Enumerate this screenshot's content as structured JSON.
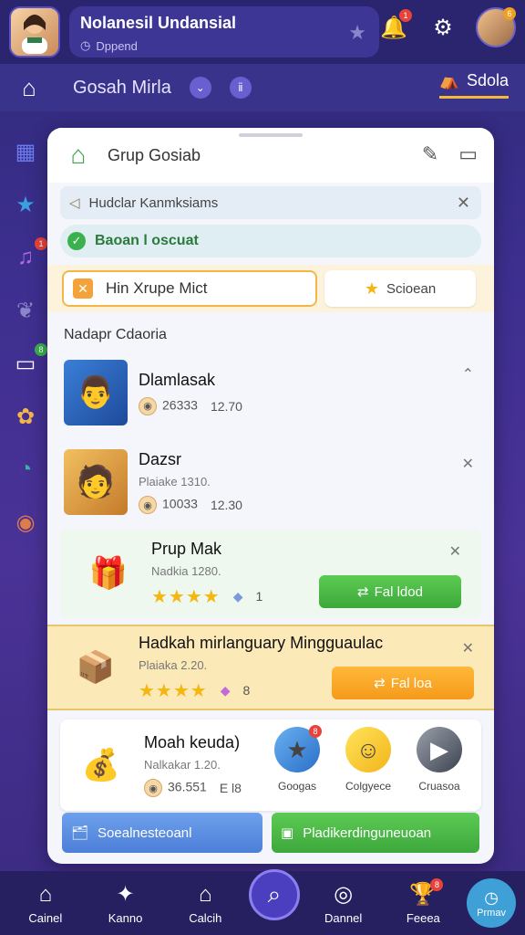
{
  "header": {
    "user_name": "Nolanesil Undansial",
    "user_status": "Dppend",
    "bell_badge": "1",
    "avatar_badge": "6"
  },
  "nav": {
    "title": "Gosah Mirla",
    "right_label": "Sdola"
  },
  "sidebar": {
    "items": [
      {
        "icon": "grid-icon",
        "color": "#6a7cf0"
      },
      {
        "icon": "star-icon",
        "color": "#3aa0e0"
      },
      {
        "icon": "music-icon",
        "color": "#b06ae8",
        "badge": "1"
      },
      {
        "icon": "leaf-icon",
        "color": "#8a86c9"
      },
      {
        "icon": "tablet-icon",
        "color": "#ffffff",
        "badge": "8"
      },
      {
        "icon": "gear-icon",
        "color": "#f3b64a"
      },
      {
        "icon": "compass-icon",
        "color": "#3bb3a4"
      },
      {
        "icon": "shell-icon",
        "color": "#e07c4a"
      }
    ]
  },
  "panel": {
    "title": "Grup Gosiab",
    "notice_text": "Hudclar Kanmksiams",
    "success_text": "Baoan l oscuat",
    "mission_label": "Hin Xrupe Mict",
    "secondary_label": "Scioean",
    "section_title": "Nadapr Cdaoria",
    "items": [
      {
        "title": "Dlamlasak",
        "meta1": "26333",
        "meta2": "12.70"
      },
      {
        "title": "Dazsr",
        "sub": "Plaiake 1310.",
        "meta1": "10033",
        "meta2": "12.30"
      },
      {
        "title": "Prup Mak",
        "sub": "Nadkia 1280.",
        "stars": "★★★★",
        "extra": "1",
        "action": "Fal ldod"
      },
      {
        "title": "Hadkah mirlanguary Mingguaulac",
        "sub": "Plaiaka 2.20.",
        "stars": "★★★★",
        "extra": "8",
        "action": "Fal loa"
      },
      {
        "title": "Moah keuda)",
        "sub": "Nalkakar 1.20.",
        "meta1": "36.551",
        "meta2": "E l8"
      }
    ],
    "bubbles": [
      {
        "label": "Googas",
        "badge": "8"
      },
      {
        "label": "Colgyece"
      },
      {
        "label": "Cruasoa"
      }
    ],
    "footer_left": "Soealnesteoanl",
    "footer_right": "Pladikerdinguneuoan"
  },
  "bottom_nav": {
    "items": [
      "Cainel",
      "Kanno",
      "Calcih",
      "Dannel",
      "Feeea",
      "Prmav"
    ],
    "badge": "8"
  },
  "colors": {
    "accent_green": "#3ca83a",
    "accent_orange": "#f59a1a",
    "brand_purple": "#3a338c"
  }
}
